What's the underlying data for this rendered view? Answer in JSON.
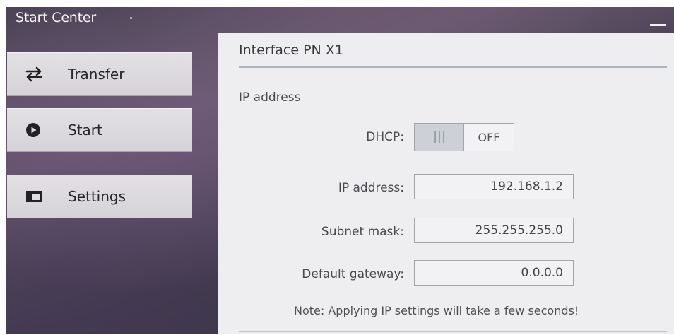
{
  "window": {
    "title": "Start Center"
  },
  "nav": {
    "items": [
      {
        "label": "Transfer",
        "icon": "transfer-arrows-icon"
      },
      {
        "label": "Start",
        "icon": "play-circle-icon"
      },
      {
        "label": "Settings",
        "icon": "settings-panel-icon"
      }
    ]
  },
  "panel": {
    "title": "Interface PN X1",
    "section_title": "IP address",
    "dhcp": {
      "label": "DHCP:",
      "state": "OFF"
    },
    "fields": [
      {
        "label": "IP address:",
        "value": "192.168.1.2"
      },
      {
        "label": "Subnet mask:",
        "value": "255.255.255.0"
      },
      {
        "label": "Default gateway:",
        "value": "0.0.0.0"
      }
    ],
    "note": "Note: Applying IP settings will take a few seconds!"
  },
  "colors": {
    "panel_background": "#eeedef",
    "nav_button_background": "#dedbe0",
    "toggle_knob": "#cdd0d6"
  }
}
